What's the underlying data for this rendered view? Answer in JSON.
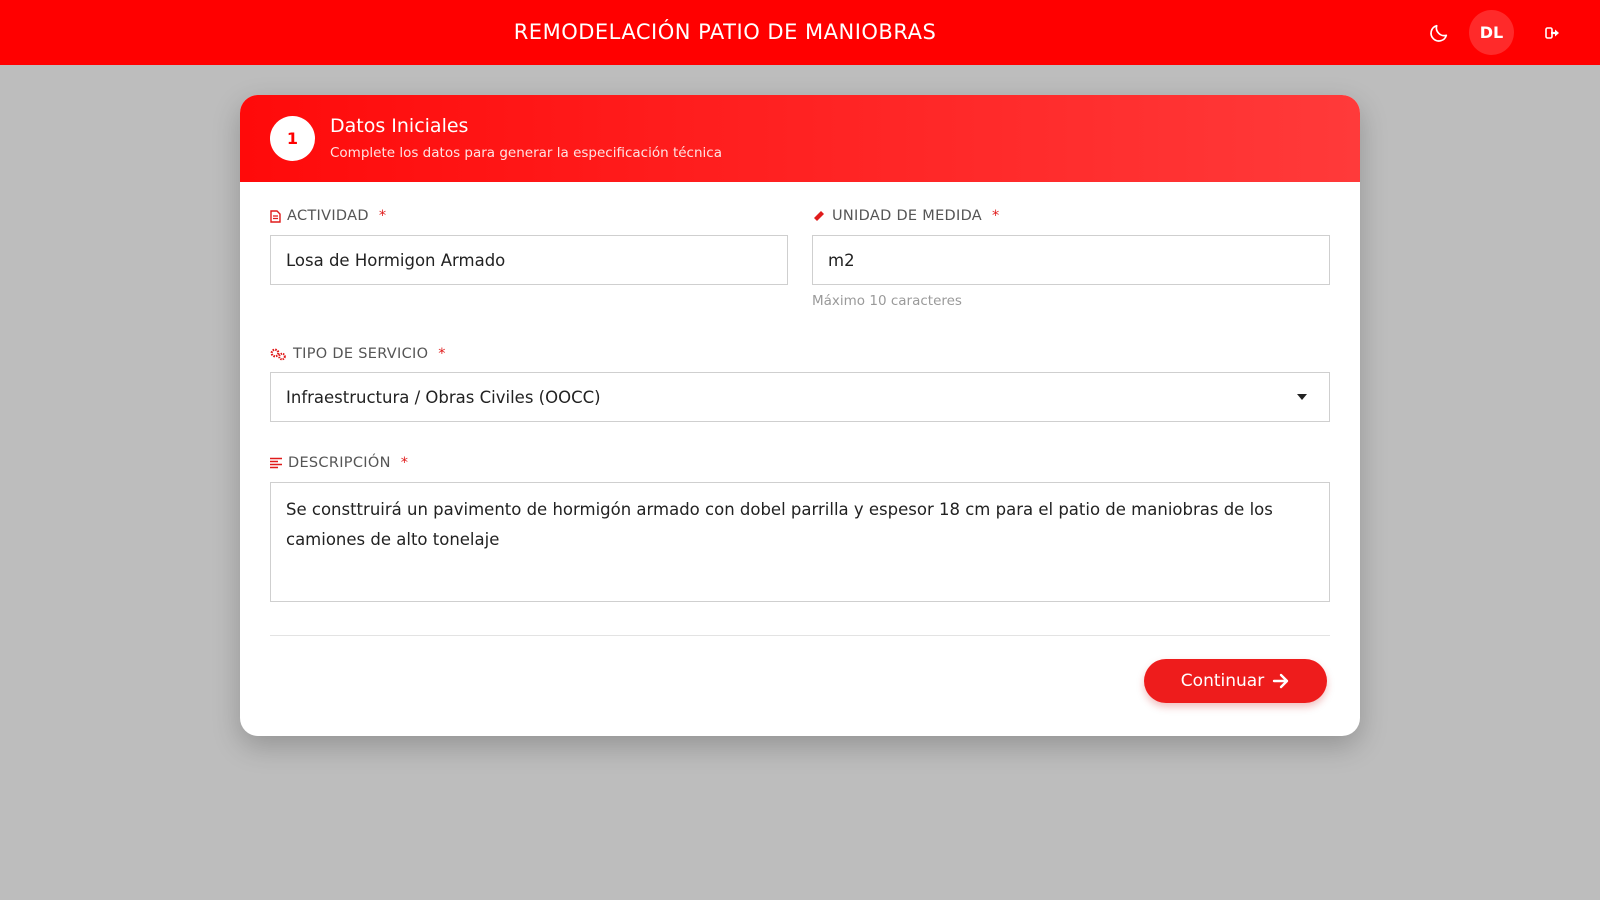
{
  "header": {
    "title": "REMODELACIÓN PATIO DE MANIOBRAS",
    "avatar_initials": "DL",
    "icons": {
      "theme": "moon-icon",
      "logout": "logout-icon"
    }
  },
  "card": {
    "step_number": "1",
    "title": "Datos Iniciales",
    "subtitle": "Complete los datos para generar la especificación técnica"
  },
  "form": {
    "actividad": {
      "label": "ACTIVIDAD",
      "required": "*",
      "value": "Losa de Hormigon Armado",
      "icon": "document-icon"
    },
    "unidad": {
      "label": "UNIDAD DE MEDIDA",
      "required": "*",
      "value": "m2",
      "hint": "Máximo 10 caracteres",
      "icon": "ruler-icon"
    },
    "tipo_servicio": {
      "label": "TIPO DE SERVICIO",
      "required": "*",
      "value": "Infraestructura / Obras Civiles (OOCC)",
      "icon": "gears-icon"
    },
    "descripcion": {
      "label": "DESCRIPCIÓN",
      "required": "*",
      "value": "Se consttruirá un pavimento de hormigón armado con dobel parrilla y espesor 18 cm para el patio de maniobras de los camiones de alto tonelaje",
      "icon": "align-left-icon"
    }
  },
  "actions": {
    "continue_label": "Continuar"
  },
  "colors": {
    "brand": "#ff0000",
    "background": "#bdbdbd",
    "button": "#ee1c1c"
  }
}
